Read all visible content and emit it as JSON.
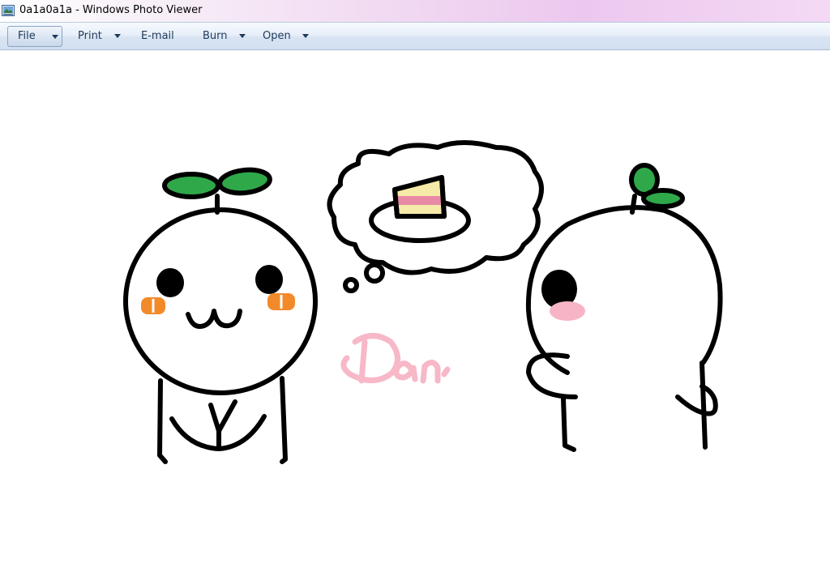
{
  "window": {
    "title": "0a1a0a1a - Windows Photo Viewer",
    "app_icon": "photo-viewer-icon"
  },
  "menu": [
    {
      "label": "File",
      "has_dropdown": true,
      "selected": true
    },
    {
      "label": "Print",
      "has_dropdown": true,
      "selected": false
    },
    {
      "label": "E-mail",
      "has_dropdown": false,
      "selected": false
    },
    {
      "label": "Burn",
      "has_dropdown": true,
      "selected": false
    },
    {
      "label": "Open",
      "has_dropdown": true,
      "selected": false
    }
  ],
  "image": {
    "signature_text": "Dan",
    "colors": {
      "outline": "#000000",
      "leaf": "#2fa84a",
      "blush_orange": "#f28a2a",
      "blush_pink": "#f7b4c6",
      "signature": "#f7b8c8",
      "cake_pink": "#e88aa6",
      "cake_cream": "#f6eaa8"
    }
  }
}
